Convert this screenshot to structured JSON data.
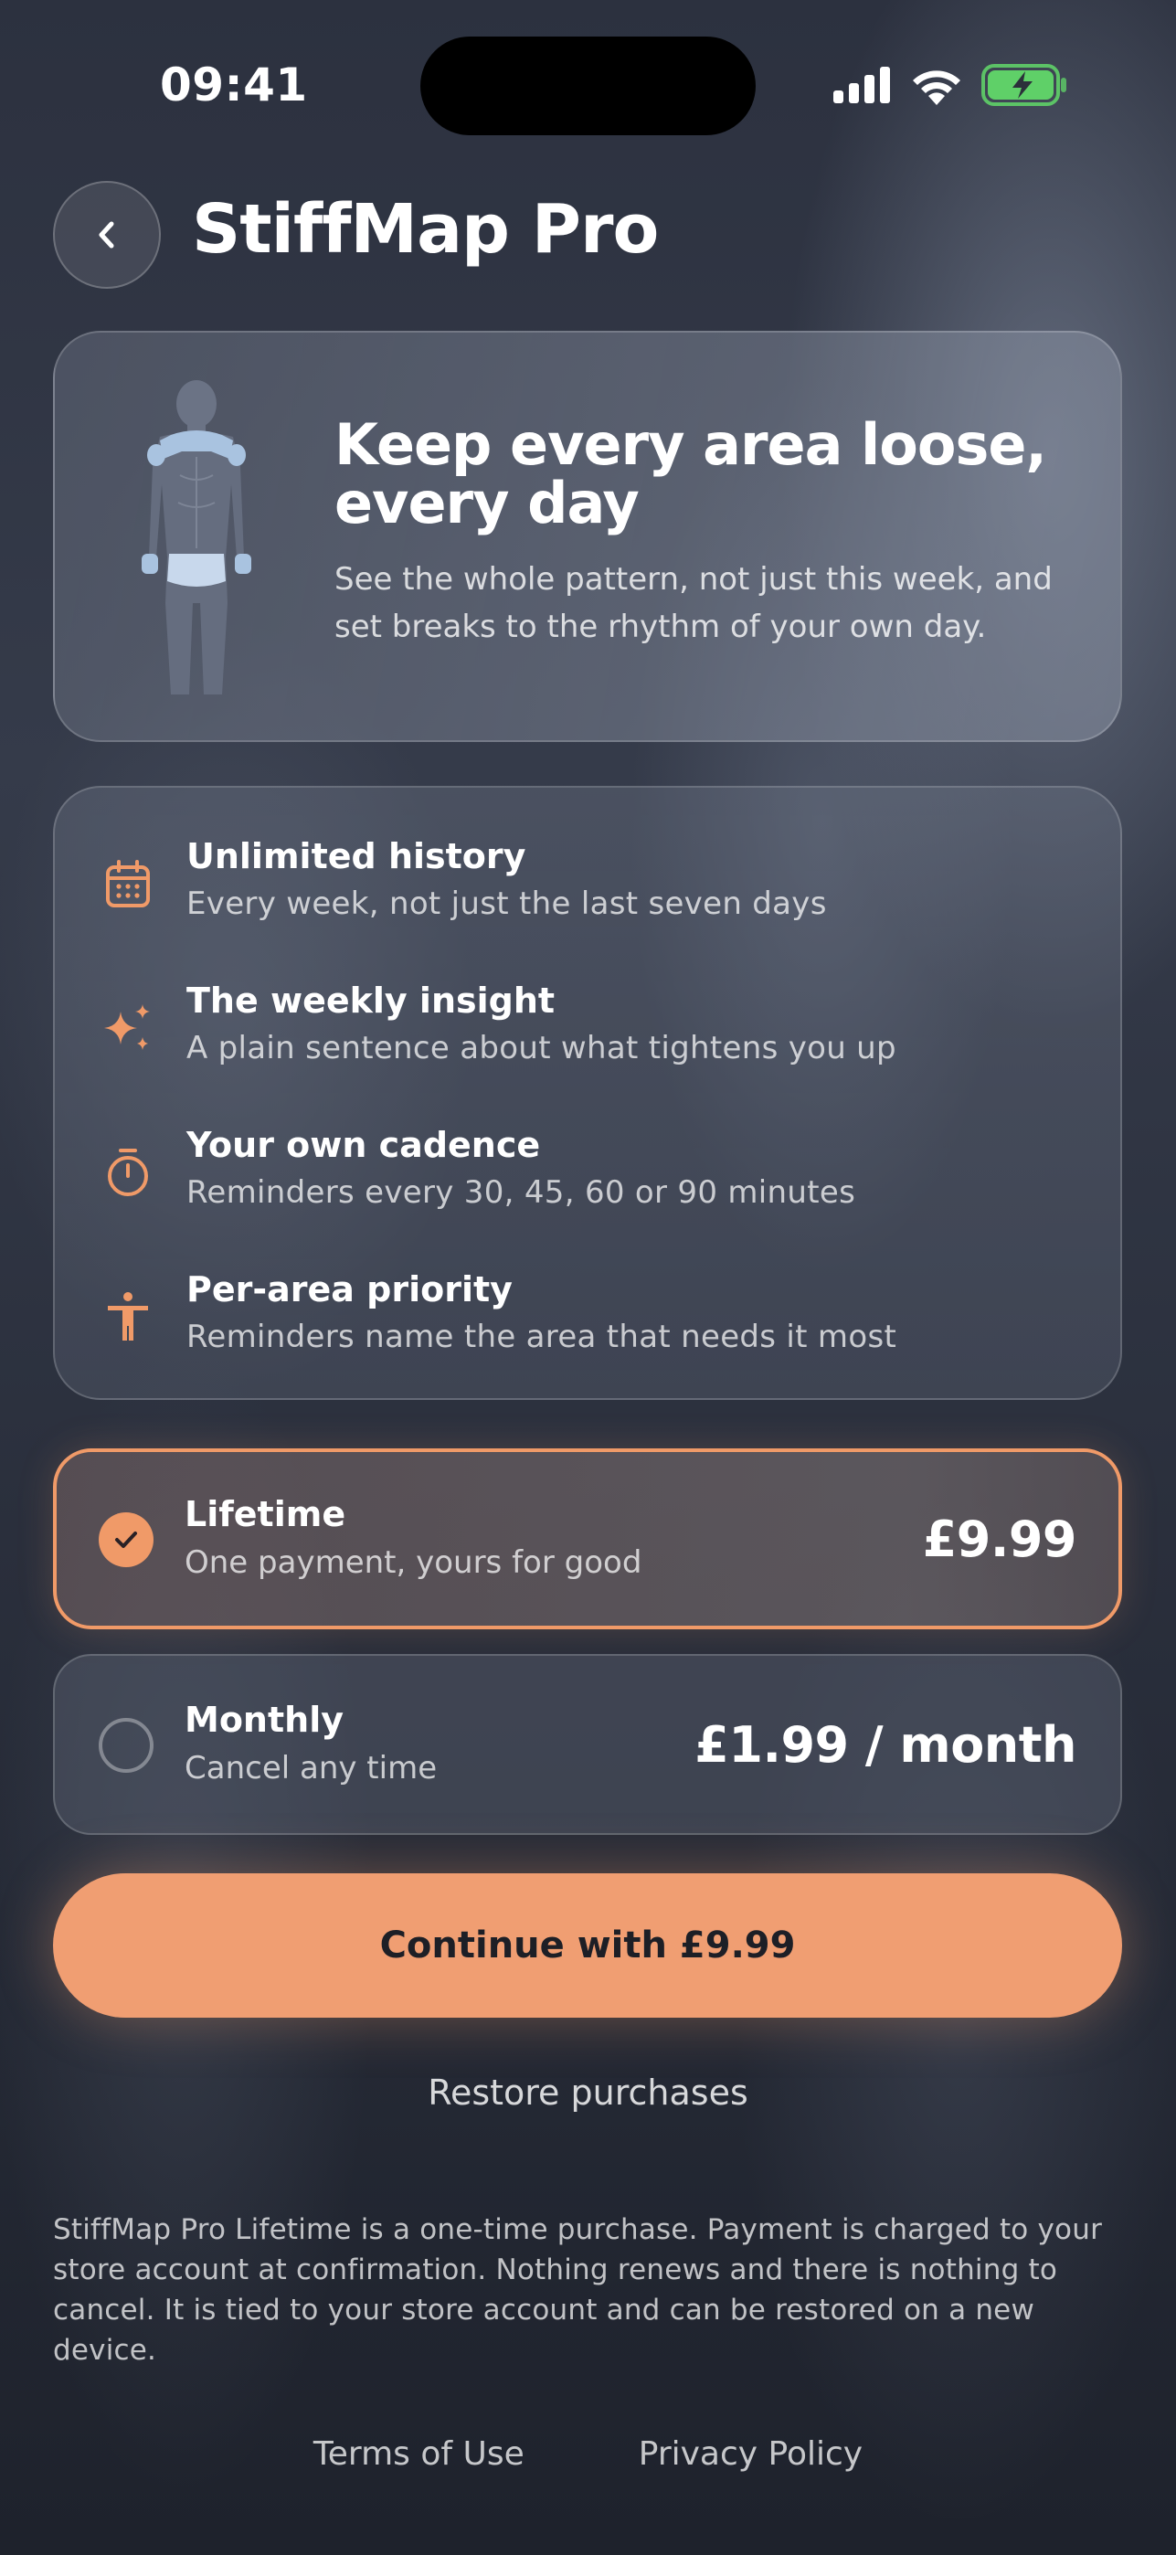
{
  "status_bar": {
    "time": "09:41"
  },
  "header": {
    "title": "StiffMap Pro"
  },
  "hero": {
    "title": "Keep every area loose, every day",
    "subtitle": "See the whole pattern, not just this week, and set breaks to the rhythm of your own day."
  },
  "features": [
    {
      "icon": "calendar-icon",
      "title": "Unlimited history",
      "desc": "Every week, not just the last seven days"
    },
    {
      "icon": "sparkles-icon",
      "title": "The weekly insight",
      "desc": "A plain sentence about what tightens you up"
    },
    {
      "icon": "timer-icon",
      "title": "Your own cadence",
      "desc": "Reminders every 30, 45, 60 or 90 minutes"
    },
    {
      "icon": "person-icon",
      "title": "Per-area priority",
      "desc": "Reminders name the area that needs it most"
    }
  ],
  "plans": {
    "lifetime": {
      "name": "Lifetime",
      "desc": "One payment, yours for good",
      "price": "£9.99",
      "selected": true
    },
    "monthly": {
      "name": "Monthly",
      "desc": "Cancel any time",
      "price": "£1.99 / month",
      "selected": false
    }
  },
  "cta": {
    "label": "Continue with £9.99"
  },
  "restore": {
    "label": "Restore purchases"
  },
  "legal": {
    "text": "StiffMap Pro Lifetime is a one-time purchase. Payment is charged to your store account at confirmation. Nothing renews and there is nothing to cancel. It is tied to your store account and can be restored on a new device."
  },
  "footer_links": {
    "terms": "Terms of Use",
    "privacy": "Privacy Policy"
  },
  "colors": {
    "accent": "#f09a68",
    "battery": "#5fd068"
  }
}
